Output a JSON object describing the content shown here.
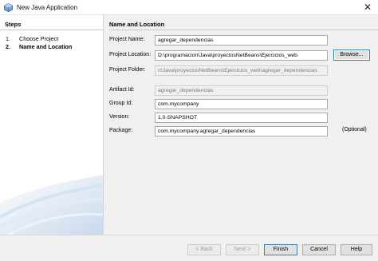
{
  "window": {
    "title": "New Java Application"
  },
  "steps": {
    "header": "Steps",
    "items": [
      {
        "num": "1.",
        "label": "Choose Project"
      },
      {
        "num": "2.",
        "label": "Name and Location"
      }
    ]
  },
  "form": {
    "header": "Name and Location",
    "project_name": {
      "label": "Project Name:",
      "value": "agregar_dependencias"
    },
    "project_location": {
      "label": "Project Location:",
      "value": "D:\\programacion\\Java\\proyectosNetBeans\\Ejercicios_web"
    },
    "browse_label": "Browse...",
    "project_folder": {
      "label": "Project Folder:",
      "value": "n\\Java\\proyectosNetBeans\\Ejercicios_web\\agregar_dependencias"
    },
    "artifact_id": {
      "label": "Artifact Id:",
      "value": "agregar_dependencias"
    },
    "group_id": {
      "label": "Group Id:",
      "value": "com.mycompany"
    },
    "version": {
      "label": "Version:",
      "value": "1.0-SNAPSHOT"
    },
    "package": {
      "label": "Package:",
      "value": "com.mycompany.agregar_dependencias"
    },
    "optional_label": "(Optional)"
  },
  "buttons": {
    "back": "< Back",
    "next": "Next >",
    "finish": "Finish",
    "cancel": "Cancel",
    "help": "Help"
  },
  "icons": {
    "app": "netbeans-cube-icon",
    "close": "close-icon"
  }
}
